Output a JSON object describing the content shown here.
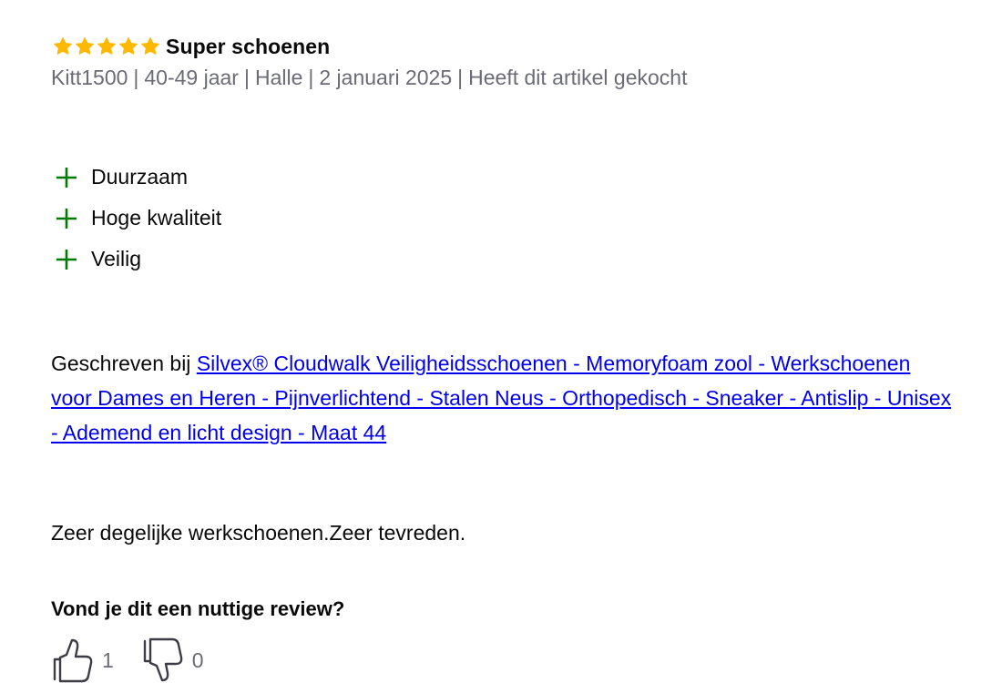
{
  "review": {
    "rating": 5,
    "max_rating": 5,
    "title": "Super schoenen",
    "meta": {
      "author": "Kitt1500",
      "age": "40-49 jaar",
      "location": "Halle",
      "date": "2 januari 2025",
      "purchase": "Heeft dit artikel gekocht",
      "separator": "|"
    },
    "pros": [
      {
        "label": "Duurzaam"
      },
      {
        "label": "Hoge kwaliteit"
      },
      {
        "label": "Veilig"
      }
    ],
    "written_for_prefix": "Geschreven bij ",
    "product_link_text": "Silvex® Cloudwalk Veiligheidsschoenen - Memoryfoam zool - Werkschoenen voor Dames en Heren - Pijnverlichtend - Stalen Neus - Orthopedisch - Sneaker - Antislip - Unisex - Ademend en licht design - Maat 44",
    "body": "Zeer degelijke werkschoenen.Zeer tevreden.",
    "helpful_question": "Vond je dit een nuttige review?",
    "votes": {
      "up_count": "1",
      "down_count": "0"
    }
  },
  "colors": {
    "star": "#ffb800",
    "plus": "#007a00",
    "link": "#0000ee",
    "meta_text": "#6b6b76",
    "icon_stroke": "#3c3c46"
  },
  "icons": {
    "star": "star-icon",
    "pro": "plus-icon",
    "vote_up": "thumbs-up-icon",
    "vote_down": "thumbs-down-icon"
  }
}
